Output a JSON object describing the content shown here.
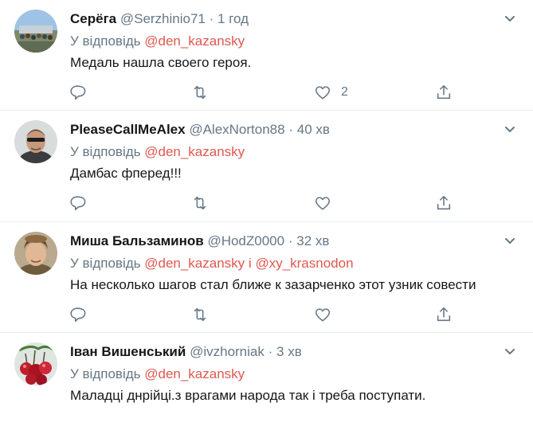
{
  "tweets": [
    {
      "name": "Серёга",
      "handle": "@Serzhinio71",
      "dot": "·",
      "time": "1 год",
      "reply_prefix": "У відповідь",
      "mentions": [
        "@den_kazansky"
      ],
      "text": "Медаль нашла своего героя.",
      "like_count": "2",
      "avatar_icon": "crowd-photo-avatar"
    },
    {
      "name": "PleaseCallMeAlex",
      "handle": "@AlexNorton88",
      "dot": "·",
      "time": "40 хв",
      "reply_prefix": "У відповідь",
      "mentions": [
        "@den_kazansky"
      ],
      "text": "Дамбас фперед!!!",
      "like_count": "",
      "avatar_icon": "face-photo-avatar"
    },
    {
      "name": "Миша Бальзаминов",
      "handle": "@HodZ0000",
      "dot": "·",
      "time": "32 хв",
      "reply_prefix": "У відповідь",
      "mentions": [
        "@den_kazansky",
        "@xy_krasnodon"
      ],
      "conjunction": "і",
      "text": "На несколько шагов стал ближе к зазарченко этот узник совести",
      "like_count": "",
      "avatar_icon": "portrait-photo-avatar"
    },
    {
      "name": "Іван Вишенський",
      "handle": "@ivzhorniak",
      "dot": "·",
      "time": "3 хв",
      "reply_prefix": "У відповідь",
      "mentions": [
        "@den_kazansky"
      ],
      "text": "Маладці днрійці.з врагами народа так і треба поступати.",
      "like_count": "",
      "avatar_icon": "cherries-photo-avatar"
    }
  ],
  "icons": {
    "reply": "reply-icon",
    "retweet": "retweet-icon",
    "like": "like-icon",
    "share": "share-icon",
    "menu": "chevron-down-icon"
  },
  "colors": {
    "mention": "#e0584f",
    "secondary_text": "#657786",
    "divider": "#e6ecf0"
  }
}
